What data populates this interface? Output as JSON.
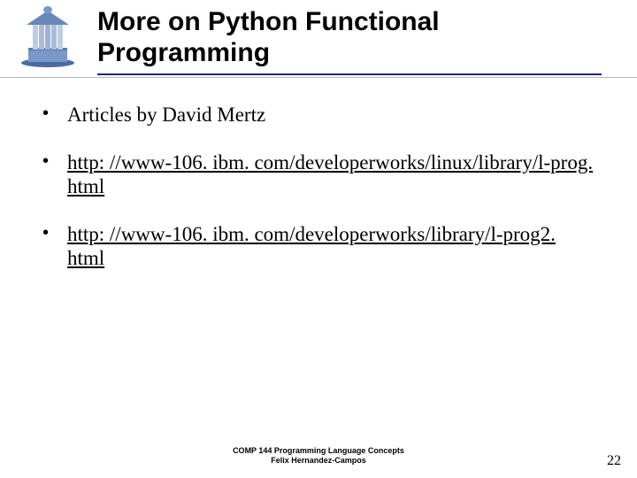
{
  "header": {
    "title": "More on Python Functional Programming"
  },
  "bullets": {
    "item1": "Articles by David Mertz",
    "item2": "http: //www-106. ibm. com/developerworks/linux/library/l-prog. html",
    "item3": "http: //www-106. ibm. com/developerworks/library/l-prog2. html"
  },
  "footer": {
    "line1": "COMP 144 Programming Language Concepts",
    "line2": "Felix Hernandez-Campos"
  },
  "page_number": "22"
}
